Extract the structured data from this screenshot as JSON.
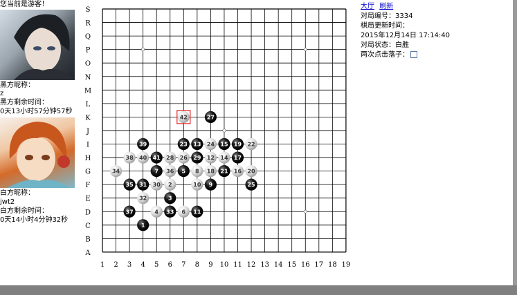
{
  "left": {
    "current_user": "您当前是游客！",
    "black_label": "黑方昵称：",
    "black_name": "z",
    "black_time_label": "黑方剩余时间：",
    "black_time": "0天13小时57分钟57秒",
    "white_label": "白方昵称：",
    "white_name": "jwt2",
    "white_time_label": "白方剩余时间：",
    "white_time": "0天14小时4分钟32秒"
  },
  "info": {
    "hall_link": "大厅",
    "refresh_link": "刷新",
    "game_id": "对局编号：3334",
    "update_label": "棋局更新时间：",
    "update_time": "2015年12月14日 17:14:40",
    "status": "对局状态：白胜",
    "double_click_label": "两次点击落子："
  },
  "board": {
    "size": 19,
    "row_labels": [
      "S",
      "R",
      "Q",
      "P",
      "O",
      "N",
      "M",
      "L",
      "K",
      "J",
      "I",
      "H",
      "G",
      "F",
      "E",
      "D",
      "C",
      "B",
      "A"
    ],
    "col_labels": [
      "1",
      "2",
      "3",
      "4",
      "5",
      "6",
      "7",
      "8",
      "9",
      "10",
      "11",
      "12",
      "13",
      "14",
      "15",
      "16",
      "17",
      "18",
      "19"
    ],
    "star_points": [
      [
        4,
        "P"
      ],
      [
        16,
        "P"
      ],
      [
        7,
        "K"
      ],
      [
        10,
        "J"
      ],
      [
        16,
        "D"
      ]
    ],
    "last_move": 42,
    "stones": [
      {
        "n": 1,
        "c": "b",
        "col": 4,
        "row": "C"
      },
      {
        "n": 2,
        "c": "w",
        "col": 6,
        "row": "F"
      },
      {
        "n": 3,
        "c": "b",
        "col": 6,
        "row": "E"
      },
      {
        "n": 4,
        "c": "w",
        "col": 5,
        "row": "D"
      },
      {
        "n": 5,
        "c": "b",
        "col": 7,
        "row": "G"
      },
      {
        "n": 6,
        "c": "w",
        "col": 7,
        "row": "D"
      },
      {
        "n": 7,
        "c": "b",
        "col": 5,
        "row": "G"
      },
      {
        "n": 8,
        "c": "w",
        "col": 8,
        "row": "G"
      },
      {
        "n": 9,
        "c": "b",
        "col": 9,
        "row": "F"
      },
      {
        "n": 10,
        "c": "w",
        "col": 8,
        "row": "F"
      },
      {
        "n": 11,
        "c": "b",
        "col": 8,
        "row": "D"
      },
      {
        "n": 12,
        "c": "w",
        "col": 9,
        "row": "H"
      },
      {
        "n": 13,
        "c": "b",
        "col": 8,
        "row": "I"
      },
      {
        "n": 14,
        "c": "w",
        "col": 10,
        "row": "H"
      },
      {
        "n": 15,
        "c": "b",
        "col": 10,
        "row": "I"
      },
      {
        "n": 16,
        "c": "w",
        "col": 11,
        "row": "G"
      },
      {
        "n": 17,
        "c": "b",
        "col": 11,
        "row": "H"
      },
      {
        "n": 18,
        "c": "w",
        "col": 9,
        "row": "G"
      },
      {
        "n": 19,
        "c": "b",
        "col": 11,
        "row": "I"
      },
      {
        "n": 20,
        "c": "w",
        "col": 12,
        "row": "G"
      },
      {
        "n": 21,
        "c": "b",
        "col": 10,
        "row": "G"
      },
      {
        "n": 22,
        "c": "w",
        "col": 12,
        "row": "I"
      },
      {
        "n": 23,
        "c": "b",
        "col": 7,
        "row": "I"
      },
      {
        "n": 24,
        "c": "w",
        "col": 9,
        "row": "I"
      },
      {
        "n": 25,
        "c": "b",
        "col": 12,
        "row": "F"
      },
      {
        "n": 26,
        "c": "w",
        "col": 7,
        "row": "H"
      },
      {
        "n": 27,
        "c": "b",
        "col": 9,
        "row": "K"
      },
      {
        "n": 28,
        "c": "w",
        "col": 6,
        "row": "H"
      },
      {
        "n": 29,
        "c": "b",
        "col": 8,
        "row": "H"
      },
      {
        "n": 30,
        "c": "w",
        "col": 5,
        "row": "F"
      },
      {
        "n": 31,
        "c": "b",
        "col": 4,
        "row": "F"
      },
      {
        "n": 32,
        "c": "w",
        "col": 4,
        "row": "E"
      },
      {
        "n": 33,
        "c": "b",
        "col": 6,
        "row": "D"
      },
      {
        "n": 34,
        "c": "w",
        "col": 2,
        "row": "G"
      },
      {
        "n": 35,
        "c": "b",
        "col": 3,
        "row": "F"
      },
      {
        "n": 36,
        "c": "w",
        "col": 6,
        "row": "G"
      },
      {
        "n": 37,
        "c": "b",
        "col": 3,
        "row": "D"
      },
      {
        "n": 38,
        "c": "w",
        "col": 3,
        "row": "H"
      },
      {
        "n": 39,
        "c": "b",
        "col": 4,
        "row": "I"
      },
      {
        "n": 40,
        "c": "w",
        "col": 4,
        "row": "H"
      },
      {
        "n": 41,
        "c": "b",
        "col": 5,
        "row": "H"
      },
      {
        "n": 42,
        "c": "w",
        "col": 7,
        "row": "K"
      }
    ]
  }
}
